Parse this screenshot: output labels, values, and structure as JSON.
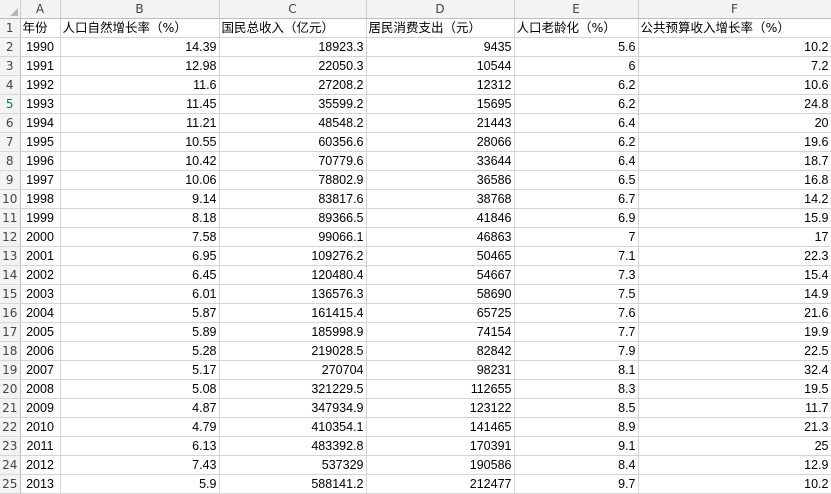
{
  "columns": [
    "A",
    "B",
    "C",
    "D",
    "E",
    "F"
  ],
  "headers": [
    "年份",
    "人口自然增长率（%）",
    "国民总收入（亿元）",
    "居民消费支出（元）",
    "人口老龄化（%）",
    "公共预算收入增长率（%）"
  ],
  "rows": [
    {
      "n": "2",
      "cells": [
        "1990",
        "14.39",
        "18923.3",
        "9435",
        "5.6",
        "10.2"
      ]
    },
    {
      "n": "3",
      "cells": [
        "1991",
        "12.98",
        "22050.3",
        "10544",
        "6",
        "7.2"
      ]
    },
    {
      "n": "4",
      "cells": [
        "1992",
        "11.6",
        "27208.2",
        "12312",
        "6.2",
        "10.6"
      ]
    },
    {
      "n": "5",
      "cells": [
        "1993",
        "11.45",
        "35599.2",
        "15695",
        "6.2",
        "24.8"
      ]
    },
    {
      "n": "6",
      "cells": [
        "1994",
        "11.21",
        "48548.2",
        "21443",
        "6.4",
        "20"
      ]
    },
    {
      "n": "7",
      "cells": [
        "1995",
        "10.55",
        "60356.6",
        "28066",
        "6.2",
        "19.6"
      ]
    },
    {
      "n": "8",
      "cells": [
        "1996",
        "10.42",
        "70779.6",
        "33644",
        "6.4",
        "18.7"
      ]
    },
    {
      "n": "9",
      "cells": [
        "1997",
        "10.06",
        "78802.9",
        "36586",
        "6.5",
        "16.8"
      ]
    },
    {
      "n": "10",
      "cells": [
        "1998",
        "9.14",
        "83817.6",
        "38768",
        "6.7",
        "14.2"
      ]
    },
    {
      "n": "11",
      "cells": [
        "1999",
        "8.18",
        "89366.5",
        "41846",
        "6.9",
        "15.9"
      ]
    },
    {
      "n": "12",
      "cells": [
        "2000",
        "7.58",
        "99066.1",
        "46863",
        "7",
        "17"
      ]
    },
    {
      "n": "13",
      "cells": [
        "2001",
        "6.95",
        "109276.2",
        "50465",
        "7.1",
        "22.3"
      ]
    },
    {
      "n": "14",
      "cells": [
        "2002",
        "6.45",
        "120480.4",
        "54667",
        "7.3",
        "15.4"
      ]
    },
    {
      "n": "15",
      "cells": [
        "2003",
        "6.01",
        "136576.3",
        "58690",
        "7.5",
        "14.9"
      ]
    },
    {
      "n": "16",
      "cells": [
        "2004",
        "5.87",
        "161415.4",
        "65725",
        "7.6",
        "21.6"
      ]
    },
    {
      "n": "17",
      "cells": [
        "2005",
        "5.89",
        "185998.9",
        "74154",
        "7.7",
        "19.9"
      ]
    },
    {
      "n": "18",
      "cells": [
        "2006",
        "5.28",
        "219028.5",
        "82842",
        "7.9",
        "22.5"
      ]
    },
    {
      "n": "19",
      "cells": [
        "2007",
        "5.17",
        "270704",
        "98231",
        "8.1",
        "32.4"
      ]
    },
    {
      "n": "20",
      "cells": [
        "2008",
        "5.08",
        "321229.5",
        "112655",
        "8.3",
        "19.5"
      ]
    },
    {
      "n": "21",
      "cells": [
        "2009",
        "4.87",
        "347934.9",
        "123122",
        "8.5",
        "11.7"
      ]
    },
    {
      "n": "22",
      "cells": [
        "2010",
        "4.79",
        "410354.1",
        "141465",
        "8.9",
        "21.3"
      ]
    },
    {
      "n": "23",
      "cells": [
        "2011",
        "6.13",
        "483392.8",
        "170391",
        "9.1",
        "25"
      ]
    },
    {
      "n": "24",
      "cells": [
        "2012",
        "7.43",
        "537329",
        "190586",
        "8.4",
        "12.9"
      ]
    },
    {
      "n": "25",
      "cells": [
        "2013",
        "5.9",
        "588141.2",
        "212477",
        "9.7",
        "10.2"
      ]
    }
  ],
  "header_row_number": "1",
  "selected_row": "5"
}
